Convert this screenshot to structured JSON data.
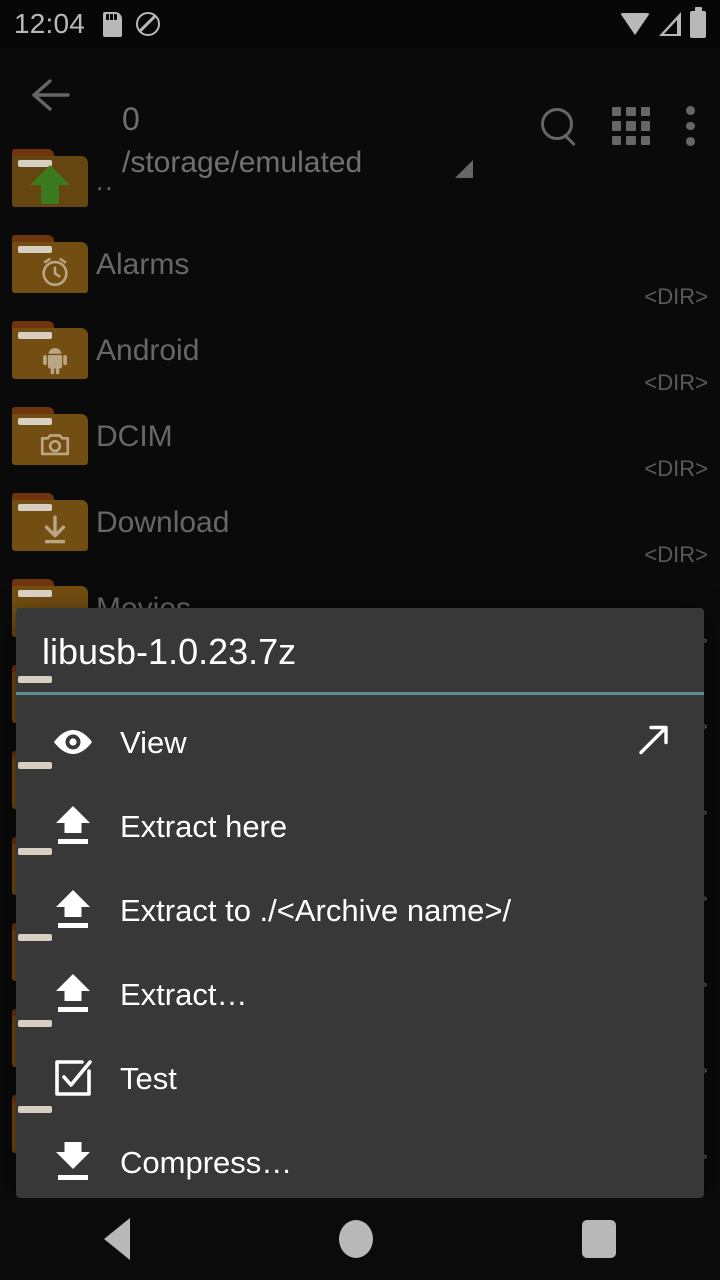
{
  "status_bar": {
    "time": "12:04",
    "icons": [
      "sd-card-icon",
      "do-not-disturb-icon",
      "wifi-icon",
      "cell-signal-icon",
      "battery-icon"
    ]
  },
  "toolbar": {
    "back_icon": "back-arrow-icon",
    "title": "0",
    "subtitle": "/storage/emulated",
    "sort_indicator": "triangle-indicator",
    "actions": [
      {
        "name": "search-icon",
        "label": "Search"
      },
      {
        "name": "grid-icon",
        "label": "Grid view"
      },
      {
        "name": "overflow-menu-icon",
        "label": "More options"
      }
    ]
  },
  "file_list": {
    "size_label_dir": "<DIR>",
    "rows": [
      {
        "name": "..",
        "icon": "folder-up-icon",
        "size": ""
      },
      {
        "name": "Alarms",
        "icon": "folder-alarm-icon",
        "size": "<DIR>"
      },
      {
        "name": "Android",
        "icon": "folder-android-icon",
        "size": "<DIR>"
      },
      {
        "name": "DCIM",
        "icon": "folder-camera-icon",
        "size": "<DIR>"
      },
      {
        "name": "Download",
        "icon": "folder-download-icon",
        "size": "<DIR>"
      },
      {
        "name": "Movies",
        "icon": "folder-movies-icon",
        "size": "<DIR>"
      }
    ],
    "obscured_size_labels": [
      ">",
      ">",
      ">",
      ">",
      ">",
      ">",
      "B"
    ]
  },
  "dialog": {
    "title": "libusb-1.0.23.7z",
    "divider_color": "#5d8e97",
    "background_color": "#383838",
    "items": [
      {
        "label": "View",
        "icon": "eye-icon",
        "trailing_icon": "external-link-icon"
      },
      {
        "label": "Extract here",
        "icon": "extract-up-icon",
        "trailing_icon": ""
      },
      {
        "label": "Extract to ./<Archive name>/",
        "icon": "extract-up-icon",
        "trailing_icon": ""
      },
      {
        "label": "Extract…",
        "icon": "extract-up-icon",
        "trailing_icon": ""
      },
      {
        "label": "Test",
        "icon": "checkbox-check-icon",
        "trailing_icon": ""
      },
      {
        "label": "Compress…",
        "icon": "compress-down-icon",
        "trailing_icon": ""
      }
    ]
  },
  "nav_bar": {
    "buttons": [
      {
        "name": "nav-back-button",
        "icon": "triangle-back-icon"
      },
      {
        "name": "nav-home-button",
        "icon": "circle-home-icon"
      },
      {
        "name": "nav-recents-button",
        "icon": "square-recents-icon"
      }
    ]
  }
}
